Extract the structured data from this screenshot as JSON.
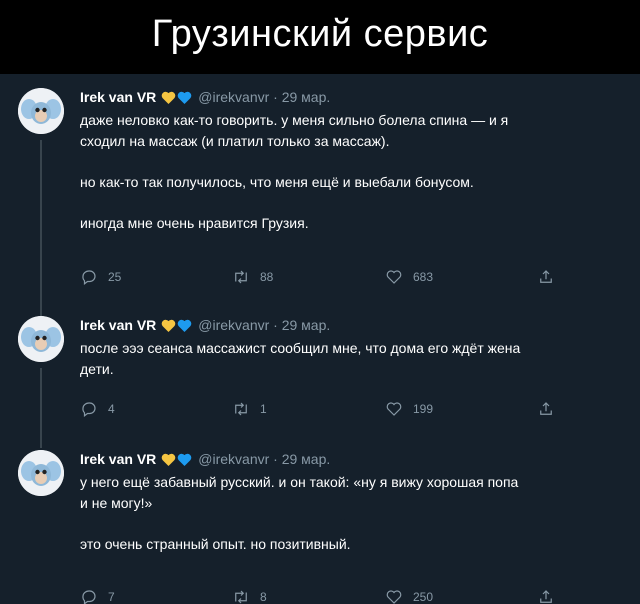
{
  "title": "Грузинский сервис",
  "tweets": [
    {
      "name": "Irek van VR",
      "handle": "@irekvanvr · 29 мар.",
      "lines": [
        "даже неловко как-то говорить. у меня сильно болела спина — и я",
        "сходил на массаж (и платил только за массаж).",
        "",
        "но как-то так получилось, что меня ещё и выебали бонусом.",
        "",
        "иногда мне очень нравится Грузия."
      ],
      "replies": "25",
      "retweets": "88",
      "likes": "683"
    },
    {
      "name": "Irek van VR",
      "handle": "@irekvanvr · 29 мар.",
      "lines": [
        "после эээ сеанса массажист сообщил мне, что дома его ждёт жена",
        "дети."
      ],
      "replies": "4",
      "retweets": "1",
      "likes": "199"
    },
    {
      "name": "Irek van VR",
      "handle": "@irekvanvr · 29 мар.",
      "lines": [
        "у него ещё забавный русский. и он такой: «ну я вижу хорошая попа",
        "и не могу!»",
        "",
        "это очень странный опыт. но позитивный."
      ],
      "replies": "7",
      "retweets": "8",
      "likes": "250"
    }
  ],
  "icons": {
    "reply": "reply-icon",
    "retweet": "retweet-icon",
    "like": "like-icon",
    "share": "share-icon",
    "yellow_heart": "#f5c542",
    "blue_heart": "#1d9bf0"
  }
}
